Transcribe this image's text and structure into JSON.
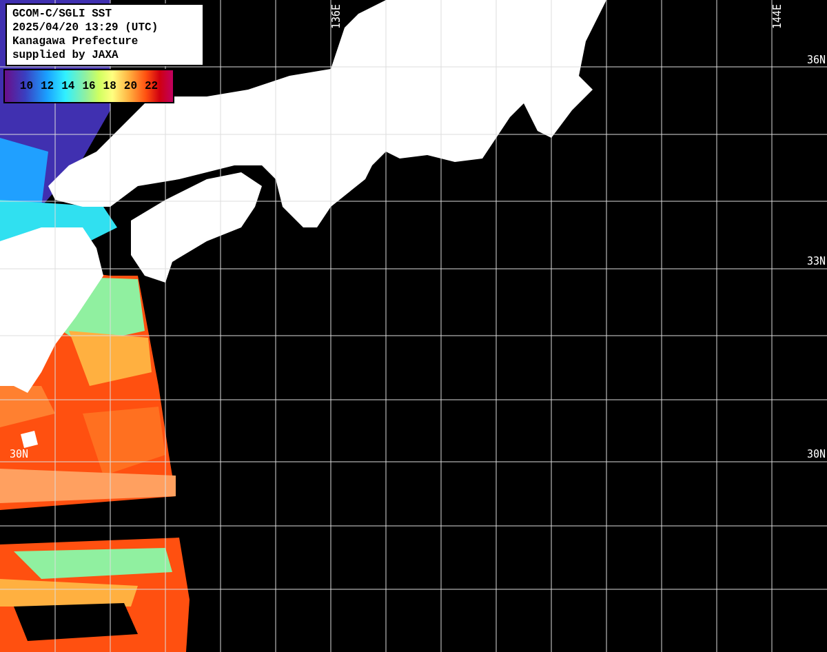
{
  "info_box": {
    "lines": [
      "GCOM-C/SGLI SST",
      "2025/04/20 13:29 (UTC)",
      "Kanagawa Prefecture",
      "supplied by JAXA"
    ]
  },
  "colorbar": {
    "ticks": [
      "10",
      "12",
      "14",
      "16",
      "18",
      "20",
      "22"
    ]
  },
  "longitude_labels": [
    "136E",
    "144E"
  ],
  "latitude_labels": [
    "36N",
    "33N",
    "30N",
    "30N"
  ]
}
